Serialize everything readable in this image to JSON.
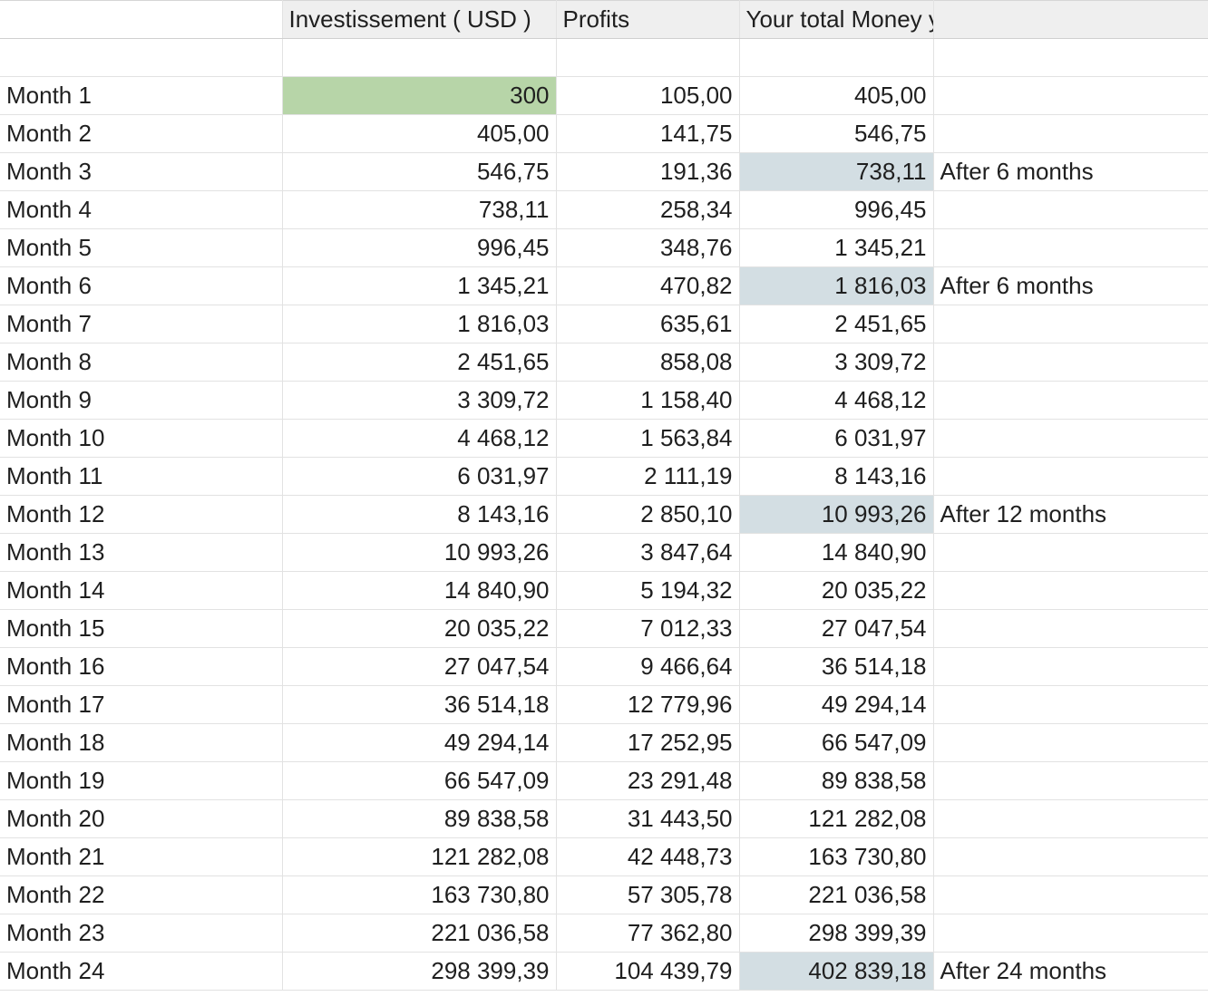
{
  "headers": {
    "row_label": "",
    "investment": "Investissement ( USD )",
    "profits": "Profits",
    "total": "Your total Money you will own",
    "note": ""
  },
  "colors": {
    "initial_investment_fill": "#b7d5a8",
    "milestone_fill": "#d3dee3",
    "header_fill": "#efefef",
    "gridline": "#e2e2e2"
  },
  "rows": [
    {
      "month": "Month 1",
      "investment": "300",
      "profits": "105,00",
      "total": "405,00",
      "note": "",
      "investment_highlight": true,
      "total_highlight": false
    },
    {
      "month": "Month 2",
      "investment": "405,00",
      "profits": "141,75",
      "total": "546,75",
      "note": "",
      "investment_highlight": false,
      "total_highlight": false
    },
    {
      "month": "Month 3",
      "investment": "546,75",
      "profits": "191,36",
      "total": "738,11",
      "note": "After 6 months",
      "investment_highlight": false,
      "total_highlight": true
    },
    {
      "month": "Month 4",
      "investment": "738,11",
      "profits": "258,34",
      "total": "996,45",
      "note": "",
      "investment_highlight": false,
      "total_highlight": false
    },
    {
      "month": "Month 5",
      "investment": "996,45",
      "profits": "348,76",
      "total": "1 345,21",
      "note": "",
      "investment_highlight": false,
      "total_highlight": false
    },
    {
      "month": "Month 6",
      "investment": "1 345,21",
      "profits": "470,82",
      "total": "1 816,03",
      "note": "After 6 months",
      "investment_highlight": false,
      "total_highlight": true
    },
    {
      "month": "Month 7",
      "investment": "1 816,03",
      "profits": "635,61",
      "total": "2 451,65",
      "note": "",
      "investment_highlight": false,
      "total_highlight": false
    },
    {
      "month": "Month 8",
      "investment": "2 451,65",
      "profits": "858,08",
      "total": "3 309,72",
      "note": "",
      "investment_highlight": false,
      "total_highlight": false
    },
    {
      "month": "Month 9",
      "investment": "3 309,72",
      "profits": "1 158,40",
      "total": "4 468,12",
      "note": "",
      "investment_highlight": false,
      "total_highlight": false
    },
    {
      "month": "Month 10",
      "investment": "4 468,12",
      "profits": "1 563,84",
      "total": "6 031,97",
      "note": "",
      "investment_highlight": false,
      "total_highlight": false
    },
    {
      "month": "Month 11",
      "investment": "6 031,97",
      "profits": "2 111,19",
      "total": "8 143,16",
      "note": "",
      "investment_highlight": false,
      "total_highlight": false
    },
    {
      "month": "Month 12",
      "investment": "8 143,16",
      "profits": "2 850,10",
      "total": "10 993,26",
      "note": "After 12 months",
      "investment_highlight": false,
      "total_highlight": true
    },
    {
      "month": "Month 13",
      "investment": "10 993,26",
      "profits": "3 847,64",
      "total": "14 840,90",
      "note": "",
      "investment_highlight": false,
      "total_highlight": false
    },
    {
      "month": "Month 14",
      "investment": "14 840,90",
      "profits": "5 194,32",
      "total": "20 035,22",
      "note": "",
      "investment_highlight": false,
      "total_highlight": false
    },
    {
      "month": "Month 15",
      "investment": "20 035,22",
      "profits": "7 012,33",
      "total": "27 047,54",
      "note": "",
      "investment_highlight": false,
      "total_highlight": false
    },
    {
      "month": "Month 16",
      "investment": "27 047,54",
      "profits": "9 466,64",
      "total": "36 514,18",
      "note": "",
      "investment_highlight": false,
      "total_highlight": false
    },
    {
      "month": "Month 17",
      "investment": "36 514,18",
      "profits": "12 779,96",
      "total": "49 294,14",
      "note": "",
      "investment_highlight": false,
      "total_highlight": false
    },
    {
      "month": "Month 18",
      "investment": "49 294,14",
      "profits": "17 252,95",
      "total": "66 547,09",
      "note": "",
      "investment_highlight": false,
      "total_highlight": false
    },
    {
      "month": "Month 19",
      "investment": "66 547,09",
      "profits": "23 291,48",
      "total": "89 838,58",
      "note": "",
      "investment_highlight": false,
      "total_highlight": false
    },
    {
      "month": "Month 20",
      "investment": "89 838,58",
      "profits": "31 443,50",
      "total": "121 282,08",
      "note": "",
      "investment_highlight": false,
      "total_highlight": false
    },
    {
      "month": "Month 21",
      "investment": "121 282,08",
      "profits": "42 448,73",
      "total": "163 730,80",
      "note": "",
      "investment_highlight": false,
      "total_highlight": false
    },
    {
      "month": "Month 22",
      "investment": "163 730,80",
      "profits": "57 305,78",
      "total": "221 036,58",
      "note": "",
      "investment_highlight": false,
      "total_highlight": false
    },
    {
      "month": "Month 23",
      "investment": "221 036,58",
      "profits": "77 362,80",
      "total": "298 399,39",
      "note": "",
      "investment_highlight": false,
      "total_highlight": false
    },
    {
      "month": "Month 24",
      "investment": "298 399,39",
      "profits": "104 439,79",
      "total": "402 839,18",
      "note": "After 24 months",
      "investment_highlight": false,
      "total_highlight": true
    }
  ]
}
